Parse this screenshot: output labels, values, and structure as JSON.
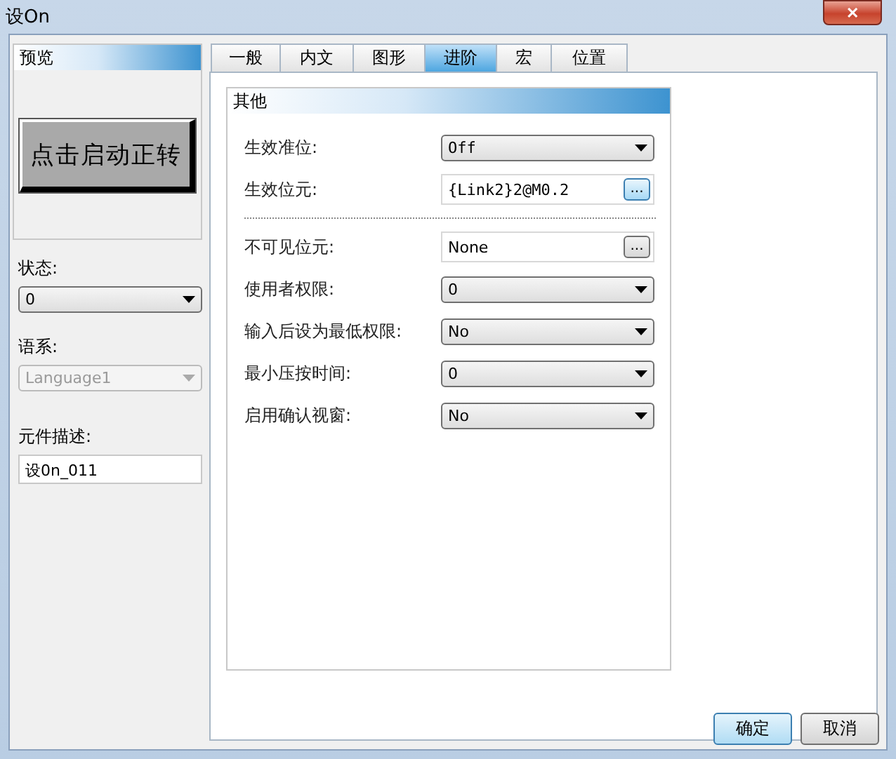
{
  "window": {
    "title": "设On",
    "close": "✕"
  },
  "preview": {
    "title": "预览",
    "button_label": "点击启动正转"
  },
  "state": {
    "label": "状态:",
    "value": "0",
    "disabled": false
  },
  "language": {
    "label": "语系:",
    "value": "Language1",
    "disabled": true
  },
  "description": {
    "label": "元件描述:",
    "value": "设0n_011"
  },
  "tabs": [
    {
      "label": "一般",
      "selected": false
    },
    {
      "label": "内文",
      "selected": false
    },
    {
      "label": "图形",
      "selected": false
    },
    {
      "label": "进阶",
      "selected": true
    },
    {
      "label": "宏",
      "selected": false
    },
    {
      "label": "位置",
      "selected": false
    }
  ],
  "group": {
    "title": "其他",
    "rows": [
      {
        "kind": "select",
        "label": "生效准位:",
        "value": "Off",
        "mono": true
      },
      {
        "kind": "browse",
        "label": "生效位元:",
        "value": "{Link2}2@M0.2",
        "mono": true,
        "button": "...",
        "highlight": true
      },
      {
        "kind": "separator"
      },
      {
        "kind": "browse",
        "label": "不可见位元:",
        "value": "None",
        "mono": false,
        "button": "...",
        "highlight": false
      },
      {
        "kind": "select",
        "label": "使用者权限:",
        "value": "0",
        "mono": false
      },
      {
        "kind": "select",
        "label": "输入后设为最低权限:",
        "value": "No",
        "mono": false
      },
      {
        "kind": "select",
        "label": "最小压按时间:",
        "value": "0",
        "mono": false
      },
      {
        "kind": "select",
        "label": "启用确认视窗:",
        "value": "No",
        "mono": false
      }
    ]
  },
  "buttons": [
    {
      "label": "确定",
      "default": true
    },
    {
      "label": "取消",
      "default": false
    }
  ]
}
